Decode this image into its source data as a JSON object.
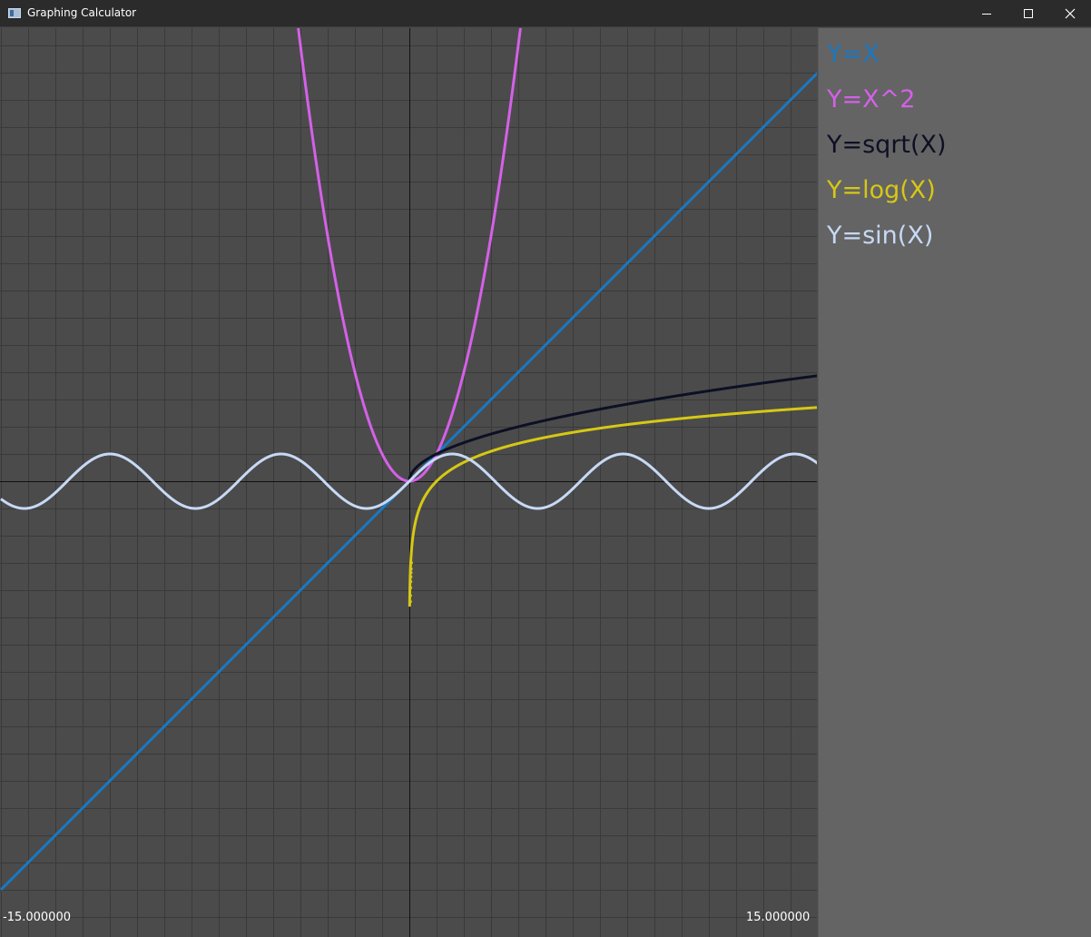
{
  "window": {
    "title": "Graphing Calculator",
    "icon": "app-window-icon",
    "controls": [
      "minimize-icon",
      "maximize-icon",
      "close-icon"
    ]
  },
  "plot": {
    "background_color": "#4b4b4b",
    "grid_color": "#3a3a3a",
    "axis_color": "#111111",
    "x_min_label": "-15.000000",
    "x_max_label": "15.000000"
  },
  "functions": [
    {
      "label": "Y=X",
      "color": "#1a78c2"
    },
    {
      "label": "Y=X^2",
      "color": "#d461e8"
    },
    {
      "label": "Y=sqrt(X)",
      "color": "#0d1024"
    },
    {
      "label": "Y=log(X)",
      "color": "#d6c814"
    },
    {
      "label": "Y=sin(X)",
      "color": "#c7d9f5"
    }
  ],
  "chart_data": {
    "type": "line",
    "xlim": [
      -15,
      15
    ],
    "ylim": [
      -15,
      15
    ],
    "grid": true,
    "series": [
      {
        "name": "Y=X",
        "expression": "x",
        "color": "#1a78c2"
      },
      {
        "name": "Y=X^2",
        "expression": "x^2",
        "color": "#d461e8"
      },
      {
        "name": "Y=sqrt(X)",
        "expression": "sqrt(x)",
        "color": "#0d1024"
      },
      {
        "name": "Y=log(X)",
        "expression": "log(x)",
        "color": "#d6c814"
      },
      {
        "name": "Y=sin(X)",
        "expression": "sin(x)",
        "color": "#c7d9f5"
      }
    ]
  }
}
